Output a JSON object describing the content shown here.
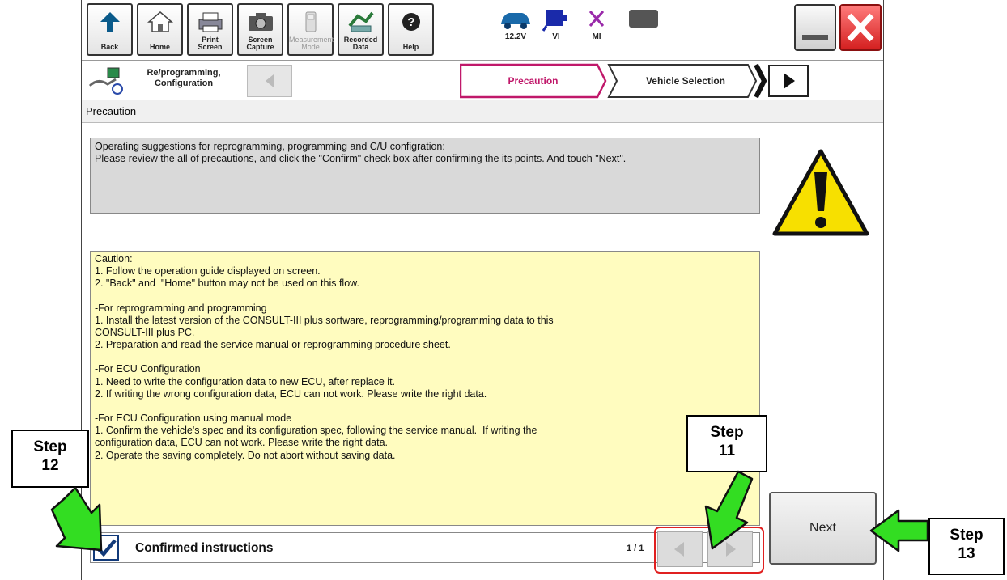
{
  "toolbar": {
    "buttons": [
      {
        "label": "Back",
        "icon": "back-arrow-icon"
      },
      {
        "label": "Home",
        "icon": "home-icon"
      },
      {
        "label": "Print Screen",
        "icon": "printer-icon"
      },
      {
        "label": "Screen Capture",
        "icon": "camera-icon"
      },
      {
        "label": "Measurement Mode",
        "icon": "meter-icon",
        "disabled": true
      },
      {
        "label": "Recorded Data",
        "icon": "data-icon"
      },
      {
        "label": "Help",
        "icon": "help-icon"
      }
    ],
    "status": [
      {
        "label": "12.2V",
        "icon": "car-battery-icon"
      },
      {
        "label": "VI",
        "icon": "vi-connector-icon"
      },
      {
        "label": "MI",
        "icon": "mi-cross-icon"
      }
    ]
  },
  "nav": {
    "breadcrumb": "Re/programming, Configuration",
    "steps": [
      "Precaution",
      "Vehicle Selection"
    ]
  },
  "section_title": "Precaution",
  "info": {
    "line1": "Operating suggestions for reprogramming, programming and C/U configration:",
    "line2": "Please review the all of precautions, and click the \"Confirm\" check box after confirming the its points. And touch \"Next\"."
  },
  "caution": {
    "lines": [
      "Caution:",
      "1. Follow the operation guide displayed on screen.",
      "2. \"Back\" and  \"Home\" button may not be used on this flow.",
      "",
      "-For reprogramming and programming",
      "1. Install the latest version of the CONSULT-III plus sortware, reprogramming/programming data to this",
      "CONSULT-III plus PC.",
      "2. Preparation and read the service manual or reprogramming procedure sheet.",
      "",
      "-For ECU Configuration",
      "1. Need to write the configuration data to new ECU, after replace it.",
      "2. If writing the wrong configuration data, ECU can not work. Please write the right data.",
      "",
      "-For ECU Configuration using manual mode",
      "1. Confirm the vehicle's spec and its configuration spec, following the service manual.  If writing the",
      "configuration data, ECU can not work. Please write the right data.",
      "2. Operate the saving completely. Do not abort without saving data."
    ]
  },
  "confirm": {
    "label": "Confirmed instructions",
    "checked": true
  },
  "pagination": {
    "indicator": "1 / 1"
  },
  "next_label": "Next",
  "callouts": {
    "step11": {
      "word": "Step",
      "num": "11"
    },
    "step12": {
      "word": "Step",
      "num": "12"
    },
    "step13": {
      "word": "Step",
      "num": "13"
    }
  },
  "colors": {
    "caution_bg": "#fffcbf",
    "info_bg": "#d9d9d9",
    "arrow_green": "#33dd22",
    "highlight_red": "#e02020",
    "warning_yellow": "#f7e000"
  }
}
